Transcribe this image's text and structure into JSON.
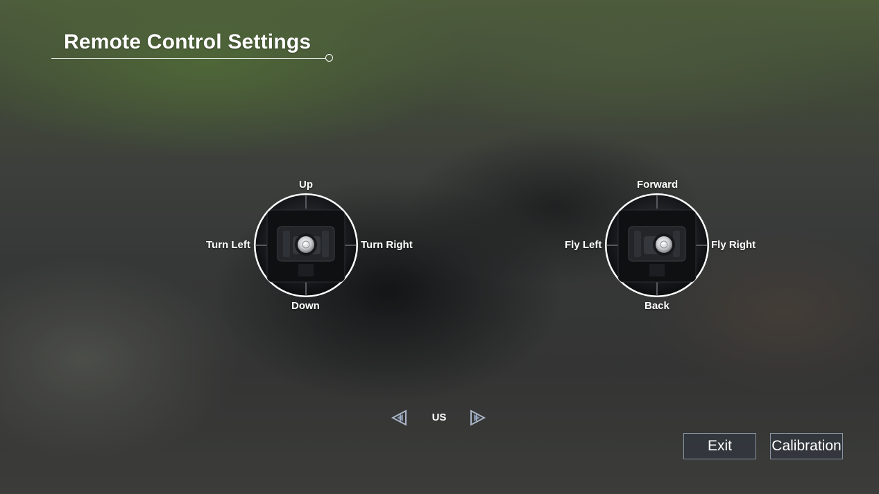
{
  "header": {
    "title": "Remote Control Settings"
  },
  "sticks": {
    "left": {
      "up": "Up",
      "down": "Down",
      "left": "Turn Left",
      "right": "Turn Right"
    },
    "right": {
      "up": "Forward",
      "down": "Back",
      "left": "Fly Left",
      "right": "Fly Right"
    }
  },
  "mode_selector": {
    "value": "US",
    "prev_icon": "triangle-left-icon",
    "next_icon": "triangle-right-icon"
  },
  "footer": {
    "exit_label": "Exit",
    "calibration_label": "Calibration"
  },
  "colors": {
    "text": "#ffffff",
    "button_border": "#96a0af",
    "button_fill": "#303640"
  }
}
